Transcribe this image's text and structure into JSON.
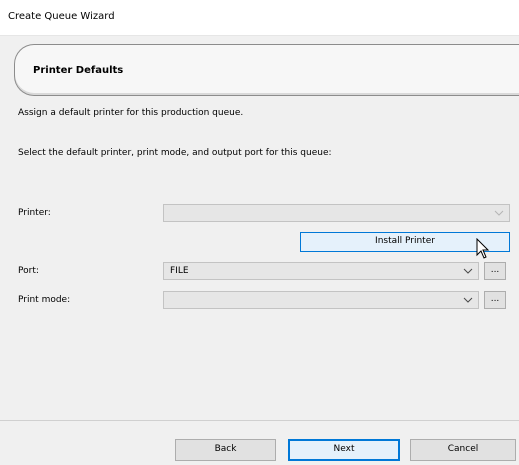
{
  "window": {
    "title": "Create Queue Wizard"
  },
  "banner": {
    "title": "Printer Defaults"
  },
  "instructions": {
    "line1": "Assign a default printer for this production queue.",
    "line2": "Select the default printer, print mode, and output port for this queue:"
  },
  "form": {
    "printer_label": "Printer:",
    "printer_value": "",
    "install_button": "Install Printer",
    "port_label": "Port:",
    "port_value": "FILE",
    "port_browse": "...",
    "print_mode_label": "Print mode:",
    "print_mode_value": "",
    "print_mode_browse": "..."
  },
  "footer": {
    "back": "Back",
    "next": "Next",
    "cancel": "Cancel"
  }
}
